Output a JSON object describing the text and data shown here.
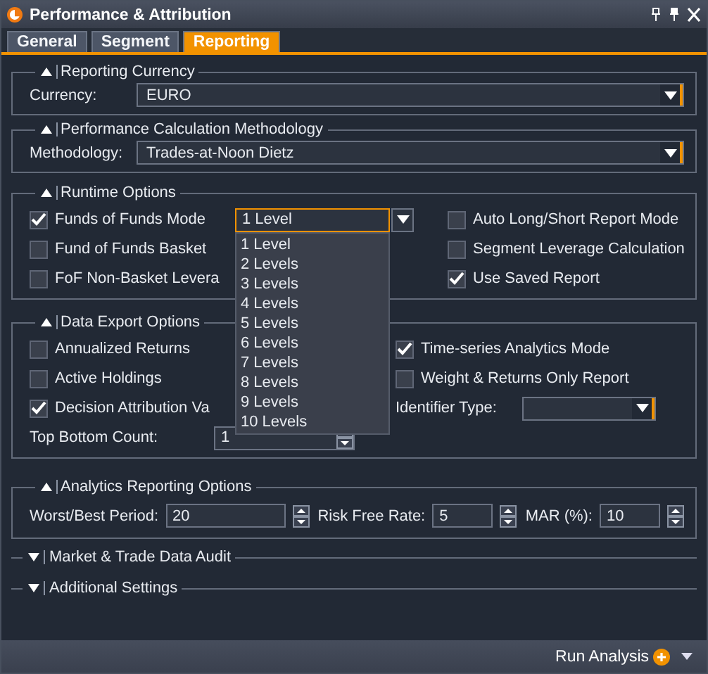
{
  "window": {
    "title": "Performance & Attribution"
  },
  "tabs": [
    {
      "label": "General",
      "selected": false
    },
    {
      "label": "Segment",
      "selected": false
    },
    {
      "label": "Reporting",
      "selected": true
    }
  ],
  "reporting_currency": {
    "title": "Reporting Currency",
    "expanded": true,
    "label": "Currency:",
    "value": "EURO"
  },
  "methodology": {
    "title": "Performance Calculation Methodology",
    "expanded": true,
    "label": "Methodology:",
    "value": "Trades-at-Noon Dietz"
  },
  "runtime_options": {
    "title": "Runtime Options",
    "expanded": true,
    "left": [
      {
        "label": "Funds of Funds Mode",
        "checked": true
      },
      {
        "label": "Fund of Funds Basket",
        "checked": false
      },
      {
        "label": "FoF Non-Basket Levera",
        "checked": false
      }
    ],
    "right": [
      {
        "label": "Auto Long/Short Report Mode",
        "checked": false
      },
      {
        "label": "Segment Leverage Calculation",
        "checked": false
      },
      {
        "label": "Use Saved Report",
        "checked": true
      }
    ],
    "fof_select": {
      "value": "1 Level",
      "open": true,
      "options": [
        "1 Level",
        "2 Levels",
        "3 Levels",
        "4 Levels",
        "5 Levels",
        "6 Levels",
        "7 Levels",
        "8 Levels",
        "9 Levels",
        "10 Levels"
      ]
    }
  },
  "data_export_options": {
    "title": "Data Export Options",
    "expanded": true,
    "left": [
      {
        "label": "Annualized Returns",
        "checked": false
      },
      {
        "label": "Active Holdings",
        "checked": false
      },
      {
        "label": "Decision Attribution Va",
        "checked": true
      }
    ],
    "right": [
      {
        "label": "Time-series Analytics Mode",
        "checked": true
      },
      {
        "label": "Weight & Returns Only Report",
        "checked": false
      }
    ],
    "identifier": {
      "label": "Identifier Type:"
    },
    "top_bottom": {
      "label": "Top Bottom Count:",
      "value": "1"
    }
  },
  "analytics_reporting_options": {
    "title": "Analytics Reporting Options",
    "expanded": true,
    "fields": [
      {
        "label": "Worst/Best Period:",
        "value": "20"
      },
      {
        "label": "Risk Free Rate:",
        "value": "5"
      },
      {
        "label": "MAR (%):",
        "value": "10"
      }
    ]
  },
  "collapsed_sections": [
    {
      "title": "Market & Trade Data Audit",
      "expanded": false
    },
    {
      "title": "Additional Settings",
      "expanded": false
    }
  ],
  "footer": {
    "button": "Run Analysis"
  }
}
